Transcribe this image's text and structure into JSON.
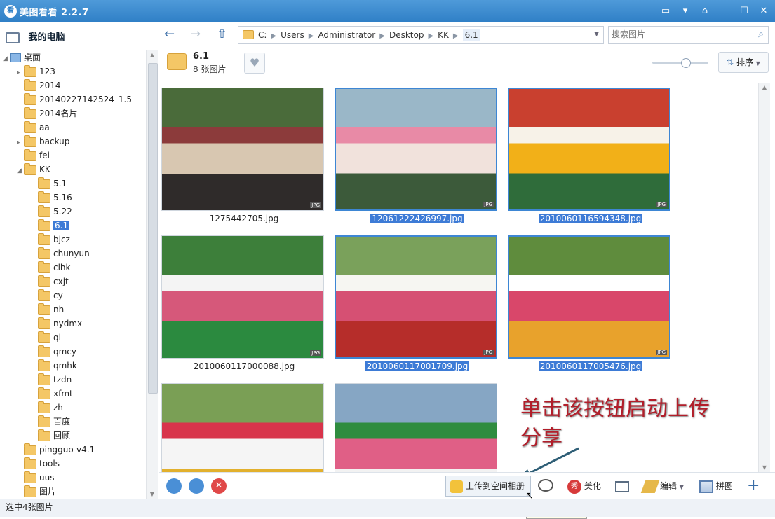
{
  "app": {
    "title": "美图看看 2.2.7",
    "icon_glyph": "看",
    "window_buttons": [
      "chat-icon",
      "menu-icon",
      "skin-icon",
      "minimize-icon",
      "maximize-icon",
      "close-icon"
    ]
  },
  "sidebar": {
    "root_label": "我的电脑",
    "tree": [
      {
        "label": "桌面",
        "level": 0,
        "icon": "desktop",
        "expanded": true
      },
      {
        "label": "123",
        "level": 1,
        "icon": "folder",
        "has_children": true
      },
      {
        "label": "2014",
        "level": 1,
        "icon": "folder"
      },
      {
        "label": "20140227142524_1.5",
        "level": 1,
        "icon": "folder"
      },
      {
        "label": "2014名片",
        "level": 1,
        "icon": "folder"
      },
      {
        "label": "aa",
        "level": 1,
        "icon": "folder"
      },
      {
        "label": "backup",
        "level": 1,
        "icon": "folder",
        "has_children": true
      },
      {
        "label": "fei",
        "level": 1,
        "icon": "folder"
      },
      {
        "label": "KK",
        "level": 1,
        "icon": "folder",
        "expanded": true
      },
      {
        "label": "5.1",
        "level": 2,
        "icon": "folder"
      },
      {
        "label": "5.16",
        "level": 2,
        "icon": "folder"
      },
      {
        "label": "5.22",
        "level": 2,
        "icon": "folder"
      },
      {
        "label": "6.1",
        "level": 2,
        "icon": "folder",
        "selected": true
      },
      {
        "label": "bjcz",
        "level": 2,
        "icon": "folder"
      },
      {
        "label": "chunyun",
        "level": 2,
        "icon": "folder"
      },
      {
        "label": "clhk",
        "level": 2,
        "icon": "folder"
      },
      {
        "label": "cxjt",
        "level": 2,
        "icon": "folder"
      },
      {
        "label": "cy",
        "level": 2,
        "icon": "folder"
      },
      {
        "label": "nh",
        "level": 2,
        "icon": "folder"
      },
      {
        "label": "nydmx",
        "level": 2,
        "icon": "folder"
      },
      {
        "label": "ql",
        "level": 2,
        "icon": "folder"
      },
      {
        "label": "qmcy",
        "level": 2,
        "icon": "folder"
      },
      {
        "label": "qmhk",
        "level": 2,
        "icon": "folder"
      },
      {
        "label": "tzdn",
        "level": 2,
        "icon": "folder"
      },
      {
        "label": "xfmt",
        "level": 2,
        "icon": "folder"
      },
      {
        "label": "zh",
        "level": 2,
        "icon": "folder"
      },
      {
        "label": "百度",
        "level": 2,
        "icon": "folder"
      },
      {
        "label": "回顾",
        "level": 2,
        "icon": "folder"
      },
      {
        "label": "pingguo-v4.1",
        "level": 1,
        "icon": "folder"
      },
      {
        "label": "tools",
        "level": 1,
        "icon": "folder"
      },
      {
        "label": "uus",
        "level": 1,
        "icon": "folder"
      },
      {
        "label": "图片",
        "level": 1,
        "icon": "folder"
      }
    ]
  },
  "nav": {
    "path": [
      "C:",
      "Users",
      "Administrator",
      "Desktop",
      "KK",
      "6.1"
    ],
    "search_placeholder": "搜索图片"
  },
  "folder_info": {
    "name": "6.1",
    "count": "8 张图片",
    "sort_label": "排序",
    "zoom_level": 0.6
  },
  "gallery": {
    "items": [
      {
        "file": "1275442705.jpg",
        "selected": false,
        "palette": [
          "#4a6b3a",
          "#d8c7b1",
          "#8c3b3b",
          "#2f2b2a"
        ],
        "badge": "JPG"
      },
      {
        "file": "12061222426997.jpg",
        "selected": true,
        "palette": [
          "#9ab7c8",
          "#f1e2dc",
          "#e88aa6",
          "#3c5a3a"
        ],
        "badge": "JPG"
      },
      {
        "file": "2010060116594348.jpg",
        "selected": true,
        "palette": [
          "#c9402f",
          "#f2b018",
          "#f7f2e8",
          "#2f6c3a"
        ],
        "badge": "JPG"
      },
      {
        "file": "2010060117000088.jpg",
        "selected": false,
        "palette": [
          "#3d7f3a",
          "#d6587a",
          "#f4f4f4",
          "#2b8a3f"
        ],
        "badge": "JPG"
      },
      {
        "file": "2010060117001709.jpg",
        "selected": true,
        "palette": [
          "#7aa15b",
          "#d65073",
          "#f6f6f2",
          "#b62d2a"
        ],
        "badge": "JPG"
      },
      {
        "file": "2010060117005476.jpg",
        "selected": true,
        "palette": [
          "#5f8c3d",
          "#d9476a",
          "#ffffff",
          "#e8a22c"
        ],
        "badge": "JPG"
      },
      {
        "file": "",
        "selected": false,
        "palette": [
          "#7a9f55",
          "#f5f5f5",
          "#d8344b",
          "#e2b02d"
        ],
        "badge": ""
      },
      {
        "file": "",
        "selected": false,
        "palette": [
          "#86a6c4",
          "#e05f86",
          "#2f8c3f",
          "#f2f2f2"
        ],
        "badge": ""
      }
    ]
  },
  "toolbar": {
    "upload_label": "上传到空间相册",
    "beautify_label": "美化",
    "edit_label": "编辑",
    "puzzle_label": "拼图",
    "tooltip": "上传到空间相册"
  },
  "annotation": {
    "line1": "单击该按钮启动上传",
    "line2": "分享"
  },
  "status": {
    "text": "选中4张图片"
  },
  "colors": {
    "accent": "#3d7bd6",
    "titlebar": "#2f7fc6",
    "annotation": "#b21e2a",
    "status_bg": "#eef2f7"
  }
}
